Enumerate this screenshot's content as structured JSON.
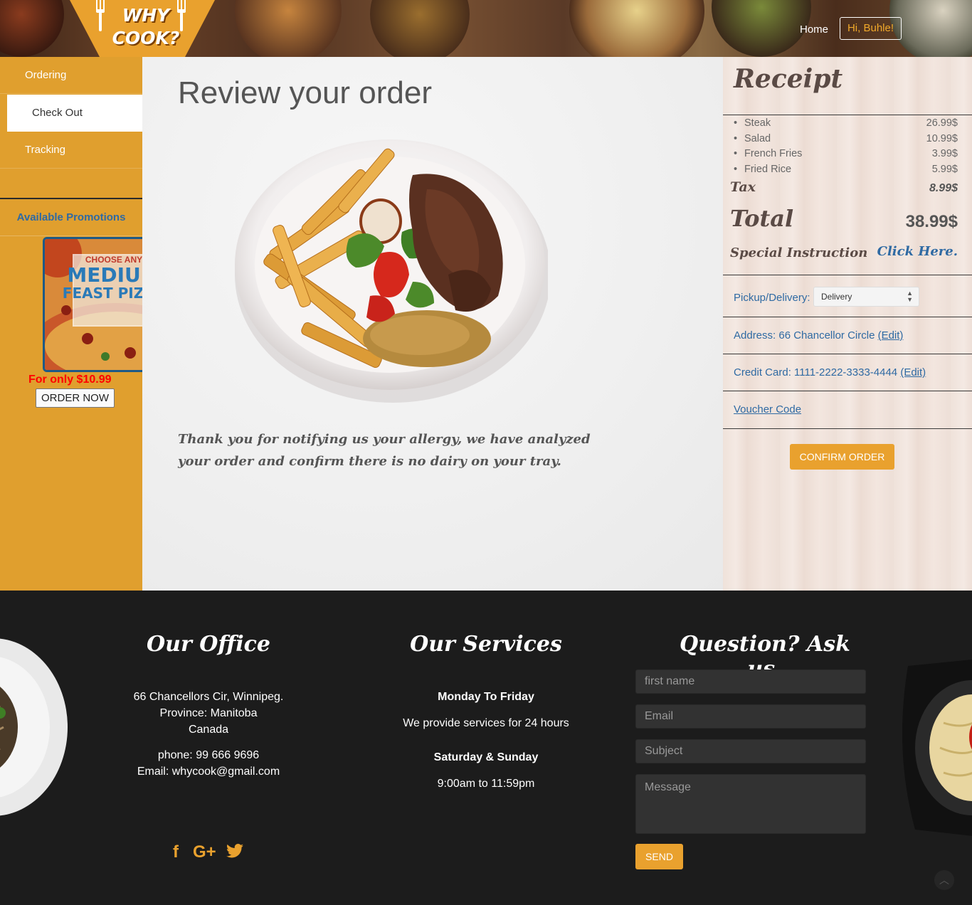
{
  "header": {
    "logo_line1": "WHY",
    "logo_line2": "COOK?",
    "home_label": "Home",
    "user_label": "Hi, Buhle!"
  },
  "sidebar": {
    "items": [
      {
        "label": "Ordering"
      },
      {
        "label": "Check Out"
      },
      {
        "label": "Tracking"
      }
    ],
    "promo_heading": "Available Promotions",
    "promo_image_text": {
      "line1": "CHOOSE ANY",
      "line2": "MEDIUM",
      "line3": "FEAST PIZZA"
    },
    "promo_price": "For only $10.99",
    "promo_button": "ORDER NOW"
  },
  "main": {
    "title": "Review your order",
    "message": "Thank you for notifying us your allergy, we have analyzed your order and confirm there is no dairy on your tray."
  },
  "receipt": {
    "title": "Receipt",
    "items": [
      {
        "name": "Steak",
        "price": "26.99$"
      },
      {
        "name": "Salad",
        "price": "10.99$"
      },
      {
        "name": "French Fries",
        "price": "3.99$"
      },
      {
        "name": "Fried Rice",
        "price": "5.99$"
      }
    ],
    "tax_label": "Tax",
    "tax_value": "8.99$",
    "total_label": "Total",
    "total_value": "38.99$",
    "special_label": "Special Instruction",
    "special_link": "Click Here.",
    "pickup_label": "Pickup/Delivery:",
    "pickup_value": "Delivery",
    "address_label": "Address: 66 Chancellor Circle",
    "credit_label": "Credit Card: 1111-2222-3333-4444",
    "edit_label": "(Edit)",
    "voucher_label": "Voucher Code",
    "confirm_button": "CONFIRM ORDER"
  },
  "footer": {
    "office_title": "Our Office",
    "office_address1": "66 Chancellors Cir, Winnipeg.",
    "office_address2": "Province: Manitoba",
    "office_address3": "Canada",
    "office_phone": "phone: 99 666 9696",
    "office_email": "Email: whycook@gmail.com",
    "services_title": "Our Services",
    "services_weekday": "Monday To Friday",
    "services_weekday_text": "We provide services for 24 hours",
    "services_weekend": "Saturday & Sunday",
    "services_weekend_text": "9:00am to 11:59pm",
    "contact_title": "Question? Ask us.",
    "first_name_placeholder": "first name",
    "email_placeholder": "Email",
    "subject_placeholder": "Subject",
    "message_placeholder": "Message",
    "send_button": "SEND",
    "social": {
      "facebook": "f",
      "google": "G+"
    }
  },
  "colors": {
    "accent": "#e9a12e",
    "sidebar": "#e09f2e",
    "link": "#2f6aa3",
    "footer_bg": "#1c1c1c",
    "promo_price": "#ff0000"
  },
  "icons": [
    "fork-icon",
    "facebook-icon",
    "google-plus-icon",
    "twitter-icon",
    "select-arrows-icon",
    "scroll-top-icon"
  ]
}
